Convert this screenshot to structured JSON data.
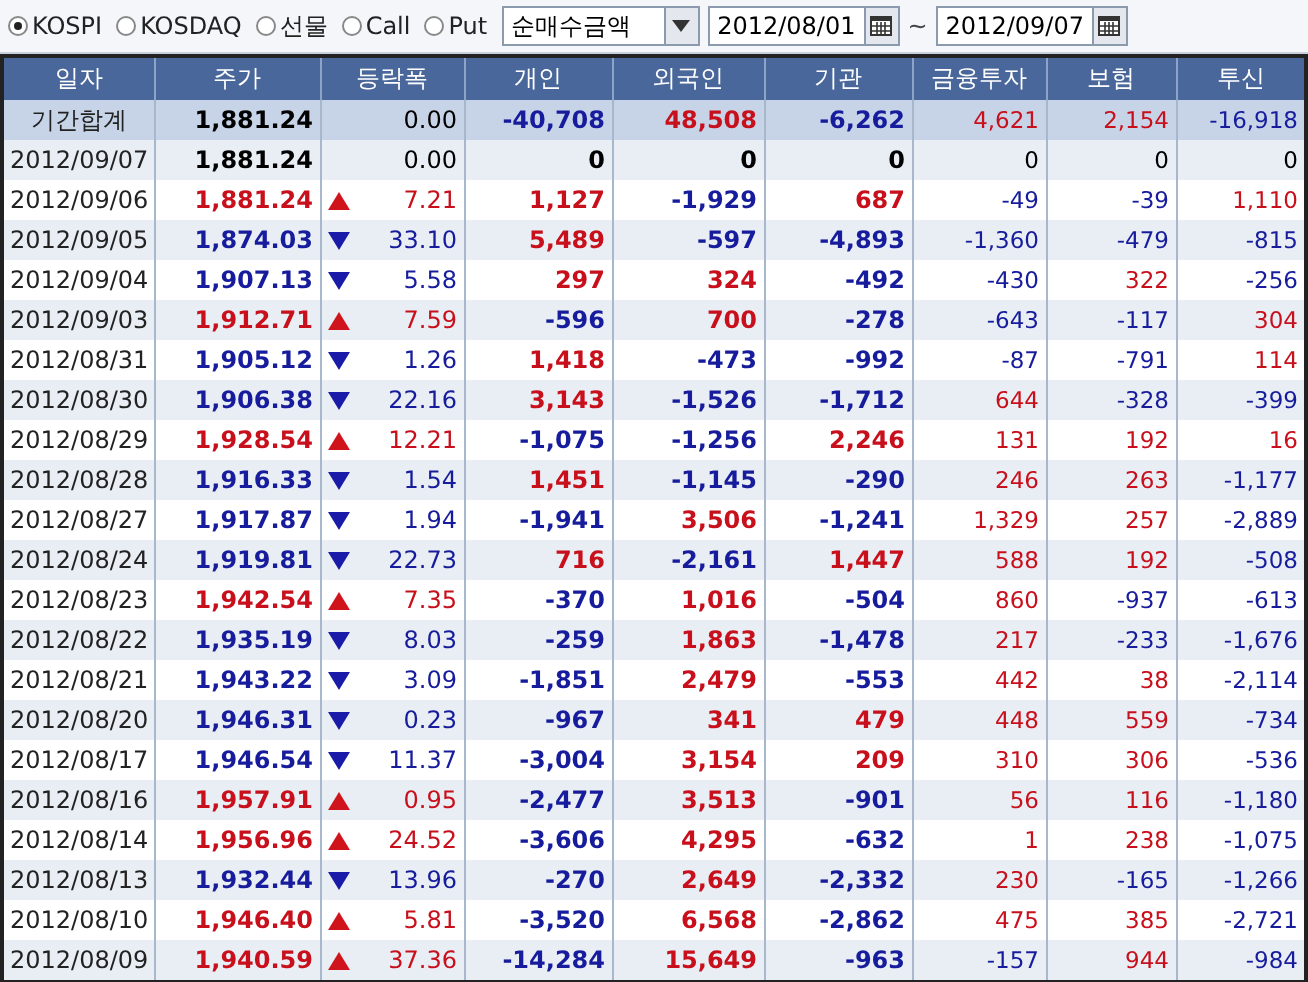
{
  "toolbar": {
    "markets": [
      {
        "label": "KOSPI",
        "selected": true
      },
      {
        "label": "KOSDAQ",
        "selected": false
      },
      {
        "label": "선물",
        "selected": false
      },
      {
        "label": "Call",
        "selected": false
      },
      {
        "label": "Put",
        "selected": false
      }
    ],
    "measure": {
      "value": "순매수금액"
    },
    "date_from": {
      "value": "2012/08/01"
    },
    "separator": "~",
    "date_to": {
      "value": "2012/09/07"
    }
  },
  "table": {
    "columns": [
      "일자",
      "주가",
      "등락폭",
      "개인",
      "외국인",
      "기관",
      "금융투자",
      "보험",
      "투신"
    ],
    "rows": [
      {
        "summary": true,
        "date": "기간합계",
        "price": "1,881.24",
        "color": "#000000",
        "rising": false,
        "falling": false,
        "change": "0.00",
        "values": [
          {
            "text": "-40,708",
            "color": "#161c9c"
          },
          {
            "text": "48,508",
            "color": "#c8101c"
          },
          {
            "text": "-6,262",
            "color": "#161c9c"
          },
          {
            "text": "4,621",
            "color": "#c8101c"
          },
          {
            "text": "2,154",
            "color": "#c8101c"
          },
          {
            "text": "-16,918",
            "color": "#161c9c"
          }
        ]
      },
      {
        "summary": false,
        "date": "2012/09/07",
        "price": "1,881.24",
        "color": "#000000",
        "rising": false,
        "falling": false,
        "change": "0.00",
        "values": [
          {
            "text": "0",
            "color": "#000000"
          },
          {
            "text": "0",
            "color": "#000000"
          },
          {
            "text": "0",
            "color": "#000000"
          },
          {
            "text": "0",
            "color": "#000000"
          },
          {
            "text": "0",
            "color": "#000000"
          },
          {
            "text": "0",
            "color": "#000000"
          }
        ]
      },
      {
        "summary": false,
        "date": "2012/09/06",
        "price": "1,881.24",
        "color": "#c8101c",
        "rising": true,
        "falling": false,
        "change": "7.21",
        "values": [
          {
            "text": "1,127",
            "color": "#c8101c"
          },
          {
            "text": "-1,929",
            "color": "#161c9c"
          },
          {
            "text": "687",
            "color": "#c8101c"
          },
          {
            "text": "-49",
            "color": "#161c9c"
          },
          {
            "text": "-39",
            "color": "#161c9c"
          },
          {
            "text": "1,110",
            "color": "#c8101c"
          }
        ]
      },
      {
        "summary": false,
        "date": "2012/09/05",
        "price": "1,874.03",
        "color": "#161c9c",
        "rising": false,
        "falling": true,
        "change": "33.10",
        "values": [
          {
            "text": "5,489",
            "color": "#c8101c"
          },
          {
            "text": "-597",
            "color": "#161c9c"
          },
          {
            "text": "-4,893",
            "color": "#161c9c"
          },
          {
            "text": "-1,360",
            "color": "#161c9c"
          },
          {
            "text": "-479",
            "color": "#161c9c"
          },
          {
            "text": "-815",
            "color": "#161c9c"
          }
        ]
      },
      {
        "summary": false,
        "date": "2012/09/04",
        "price": "1,907.13",
        "color": "#161c9c",
        "rising": false,
        "falling": true,
        "change": "5.58",
        "values": [
          {
            "text": "297",
            "color": "#c8101c"
          },
          {
            "text": "324",
            "color": "#c8101c"
          },
          {
            "text": "-492",
            "color": "#161c9c"
          },
          {
            "text": "-430",
            "color": "#161c9c"
          },
          {
            "text": "322",
            "color": "#c8101c"
          },
          {
            "text": "-256",
            "color": "#161c9c"
          }
        ]
      },
      {
        "summary": false,
        "date": "2012/09/03",
        "price": "1,912.71",
        "color": "#c8101c",
        "rising": true,
        "falling": false,
        "change": "7.59",
        "values": [
          {
            "text": "-596",
            "color": "#161c9c"
          },
          {
            "text": "700",
            "color": "#c8101c"
          },
          {
            "text": "-278",
            "color": "#161c9c"
          },
          {
            "text": "-643",
            "color": "#161c9c"
          },
          {
            "text": "-117",
            "color": "#161c9c"
          },
          {
            "text": "304",
            "color": "#c8101c"
          }
        ]
      },
      {
        "summary": false,
        "date": "2012/08/31",
        "price": "1,905.12",
        "color": "#161c9c",
        "rising": false,
        "falling": true,
        "change": "1.26",
        "values": [
          {
            "text": "1,418",
            "color": "#c8101c"
          },
          {
            "text": "-473",
            "color": "#161c9c"
          },
          {
            "text": "-992",
            "color": "#161c9c"
          },
          {
            "text": "-87",
            "color": "#161c9c"
          },
          {
            "text": "-791",
            "color": "#161c9c"
          },
          {
            "text": "114",
            "color": "#c8101c"
          }
        ]
      },
      {
        "summary": false,
        "date": "2012/08/30",
        "price": "1,906.38",
        "color": "#161c9c",
        "rising": false,
        "falling": true,
        "change": "22.16",
        "values": [
          {
            "text": "3,143",
            "color": "#c8101c"
          },
          {
            "text": "-1,526",
            "color": "#161c9c"
          },
          {
            "text": "-1,712",
            "color": "#161c9c"
          },
          {
            "text": "644",
            "color": "#c8101c"
          },
          {
            "text": "-328",
            "color": "#161c9c"
          },
          {
            "text": "-399",
            "color": "#161c9c"
          }
        ]
      },
      {
        "summary": false,
        "date": "2012/08/29",
        "price": "1,928.54",
        "color": "#c8101c",
        "rising": true,
        "falling": false,
        "change": "12.21",
        "values": [
          {
            "text": "-1,075",
            "color": "#161c9c"
          },
          {
            "text": "-1,256",
            "color": "#161c9c"
          },
          {
            "text": "2,246",
            "color": "#c8101c"
          },
          {
            "text": "131",
            "color": "#c8101c"
          },
          {
            "text": "192",
            "color": "#c8101c"
          },
          {
            "text": "16",
            "color": "#c8101c"
          }
        ]
      },
      {
        "summary": false,
        "date": "2012/08/28",
        "price": "1,916.33",
        "color": "#161c9c",
        "rising": false,
        "falling": true,
        "change": "1.54",
        "values": [
          {
            "text": "1,451",
            "color": "#c8101c"
          },
          {
            "text": "-1,145",
            "color": "#161c9c"
          },
          {
            "text": "-290",
            "color": "#161c9c"
          },
          {
            "text": "246",
            "color": "#c8101c"
          },
          {
            "text": "263",
            "color": "#c8101c"
          },
          {
            "text": "-1,177",
            "color": "#161c9c"
          }
        ]
      },
      {
        "summary": false,
        "date": "2012/08/27",
        "price": "1,917.87",
        "color": "#161c9c",
        "rising": false,
        "falling": true,
        "change": "1.94",
        "values": [
          {
            "text": "-1,941",
            "color": "#161c9c"
          },
          {
            "text": "3,506",
            "color": "#c8101c"
          },
          {
            "text": "-1,241",
            "color": "#161c9c"
          },
          {
            "text": "1,329",
            "color": "#c8101c"
          },
          {
            "text": "257",
            "color": "#c8101c"
          },
          {
            "text": "-2,889",
            "color": "#161c9c"
          }
        ]
      },
      {
        "summary": false,
        "date": "2012/08/24",
        "price": "1,919.81",
        "color": "#161c9c",
        "rising": false,
        "falling": true,
        "change": "22.73",
        "values": [
          {
            "text": "716",
            "color": "#c8101c"
          },
          {
            "text": "-2,161",
            "color": "#161c9c"
          },
          {
            "text": "1,447",
            "color": "#c8101c"
          },
          {
            "text": "588",
            "color": "#c8101c"
          },
          {
            "text": "192",
            "color": "#c8101c"
          },
          {
            "text": "-508",
            "color": "#161c9c"
          }
        ]
      },
      {
        "summary": false,
        "date": "2012/08/23",
        "price": "1,942.54",
        "color": "#c8101c",
        "rising": true,
        "falling": false,
        "change": "7.35",
        "values": [
          {
            "text": "-370",
            "color": "#161c9c"
          },
          {
            "text": "1,016",
            "color": "#c8101c"
          },
          {
            "text": "-504",
            "color": "#161c9c"
          },
          {
            "text": "860",
            "color": "#c8101c"
          },
          {
            "text": "-937",
            "color": "#161c9c"
          },
          {
            "text": "-613",
            "color": "#161c9c"
          }
        ]
      },
      {
        "summary": false,
        "date": "2012/08/22",
        "price": "1,935.19",
        "color": "#161c9c",
        "rising": false,
        "falling": true,
        "change": "8.03",
        "values": [
          {
            "text": "-259",
            "color": "#161c9c"
          },
          {
            "text": "1,863",
            "color": "#c8101c"
          },
          {
            "text": "-1,478",
            "color": "#161c9c"
          },
          {
            "text": "217",
            "color": "#c8101c"
          },
          {
            "text": "-233",
            "color": "#161c9c"
          },
          {
            "text": "-1,676",
            "color": "#161c9c"
          }
        ]
      },
      {
        "summary": false,
        "date": "2012/08/21",
        "price": "1,943.22",
        "color": "#161c9c",
        "rising": false,
        "falling": true,
        "change": "3.09",
        "values": [
          {
            "text": "-1,851",
            "color": "#161c9c"
          },
          {
            "text": "2,479",
            "color": "#c8101c"
          },
          {
            "text": "-553",
            "color": "#161c9c"
          },
          {
            "text": "442",
            "color": "#c8101c"
          },
          {
            "text": "38",
            "color": "#c8101c"
          },
          {
            "text": "-2,114",
            "color": "#161c9c"
          }
        ]
      },
      {
        "summary": false,
        "date": "2012/08/20",
        "price": "1,946.31",
        "color": "#161c9c",
        "rising": false,
        "falling": true,
        "change": "0.23",
        "values": [
          {
            "text": "-967",
            "color": "#161c9c"
          },
          {
            "text": "341",
            "color": "#c8101c"
          },
          {
            "text": "479",
            "color": "#c8101c"
          },
          {
            "text": "448",
            "color": "#c8101c"
          },
          {
            "text": "559",
            "color": "#c8101c"
          },
          {
            "text": "-734",
            "color": "#161c9c"
          }
        ]
      },
      {
        "summary": false,
        "date": "2012/08/17",
        "price": "1,946.54",
        "color": "#161c9c",
        "rising": false,
        "falling": true,
        "change": "11.37",
        "values": [
          {
            "text": "-3,004",
            "color": "#161c9c"
          },
          {
            "text": "3,154",
            "color": "#c8101c"
          },
          {
            "text": "209",
            "color": "#c8101c"
          },
          {
            "text": "310",
            "color": "#c8101c"
          },
          {
            "text": "306",
            "color": "#c8101c"
          },
          {
            "text": "-536",
            "color": "#161c9c"
          }
        ]
      },
      {
        "summary": false,
        "date": "2012/08/16",
        "price": "1,957.91",
        "color": "#c8101c",
        "rising": true,
        "falling": false,
        "change": "0.95",
        "values": [
          {
            "text": "-2,477",
            "color": "#161c9c"
          },
          {
            "text": "3,513",
            "color": "#c8101c"
          },
          {
            "text": "-901",
            "color": "#161c9c"
          },
          {
            "text": "56",
            "color": "#c8101c"
          },
          {
            "text": "116",
            "color": "#c8101c"
          },
          {
            "text": "-1,180",
            "color": "#161c9c"
          }
        ]
      },
      {
        "summary": false,
        "date": "2012/08/14",
        "price": "1,956.96",
        "color": "#c8101c",
        "rising": true,
        "falling": false,
        "change": "24.52",
        "values": [
          {
            "text": "-3,606",
            "color": "#161c9c"
          },
          {
            "text": "4,295",
            "color": "#c8101c"
          },
          {
            "text": "-632",
            "color": "#161c9c"
          },
          {
            "text": "1",
            "color": "#c8101c"
          },
          {
            "text": "238",
            "color": "#c8101c"
          },
          {
            "text": "-1,075",
            "color": "#161c9c"
          }
        ]
      },
      {
        "summary": false,
        "date": "2012/08/13",
        "price": "1,932.44",
        "color": "#161c9c",
        "rising": false,
        "falling": true,
        "change": "13.96",
        "values": [
          {
            "text": "-270",
            "color": "#161c9c"
          },
          {
            "text": "2,649",
            "color": "#c8101c"
          },
          {
            "text": "-2,332",
            "color": "#161c9c"
          },
          {
            "text": "230",
            "color": "#c8101c"
          },
          {
            "text": "-165",
            "color": "#161c9c"
          },
          {
            "text": "-1,266",
            "color": "#161c9c"
          }
        ]
      },
      {
        "summary": false,
        "date": "2012/08/10",
        "price": "1,946.40",
        "color": "#c8101c",
        "rising": true,
        "falling": false,
        "change": "5.81",
        "values": [
          {
            "text": "-3,520",
            "color": "#161c9c"
          },
          {
            "text": "6,568",
            "color": "#c8101c"
          },
          {
            "text": "-2,862",
            "color": "#161c9c"
          },
          {
            "text": "475",
            "color": "#c8101c"
          },
          {
            "text": "385",
            "color": "#c8101c"
          },
          {
            "text": "-2,721",
            "color": "#161c9c"
          }
        ]
      },
      {
        "summary": false,
        "date": "2012/08/09",
        "price": "1,940.59",
        "color": "#c8101c",
        "rising": true,
        "falling": false,
        "change": "37.36",
        "values": [
          {
            "text": "-14,284",
            "color": "#161c9c"
          },
          {
            "text": "15,649",
            "color": "#c8101c"
          },
          {
            "text": "-963",
            "color": "#161c9c"
          },
          {
            "text": "-157",
            "color": "#161c9c"
          },
          {
            "text": "944",
            "color": "#c8101c"
          },
          {
            "text": "-984",
            "color": "#161c9c"
          }
        ]
      }
    ]
  }
}
